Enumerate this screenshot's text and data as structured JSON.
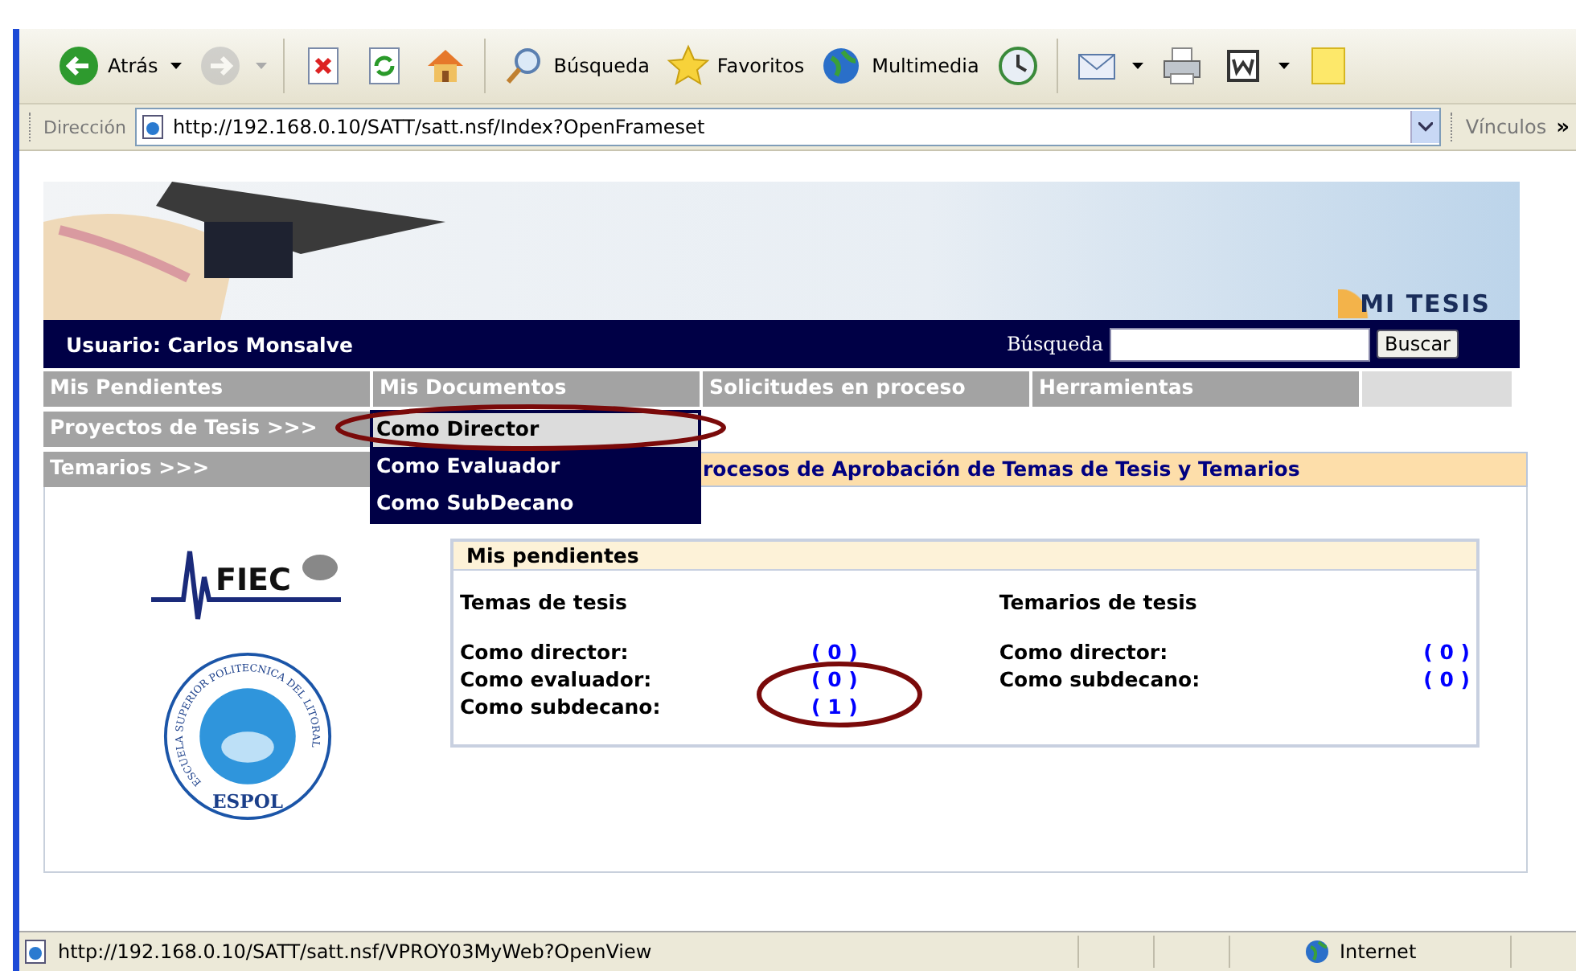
{
  "toolbar": [
    {
      "kind": "back",
      "label": "Atrás",
      "caret": true,
      "disabled": false
    },
    {
      "kind": "forward",
      "caret": true,
      "disabled": true
    },
    {
      "kind": "stop",
      "disabled": false
    },
    {
      "kind": "refresh",
      "disabled": false
    },
    {
      "kind": "home",
      "disabled": false
    },
    {
      "kind": "search",
      "label": "Búsqueda",
      "disabled": false
    },
    {
      "kind": "favorites",
      "label": "Favoritos",
      "disabled": false
    },
    {
      "kind": "media",
      "label": "Multimedia",
      "disabled": false
    },
    {
      "kind": "history",
      "disabled": false
    },
    {
      "kind": "mail",
      "caret": true,
      "disabled": false
    },
    {
      "kind": "print",
      "disabled": false
    },
    {
      "kind": "edit",
      "caret": true,
      "disabled": false
    },
    {
      "kind": "note",
      "disabled": false
    }
  ],
  "address_bar": {
    "label": "Dirección",
    "url": "http://192.168.0.10/SATT/satt.nsf/Index?OpenFrameset",
    "links_label": "Vínculos",
    "more": "»"
  },
  "page": {
    "banner_title": "MI TESIS",
    "user": "Usuario: Carlos Monsalve",
    "search": {
      "label": "Búsqueda",
      "button": "Buscar"
    },
    "menu": [
      {
        "label": "Mis Pendientes"
      },
      {
        "label": "Mis Documentos"
      },
      {
        "label": "Solicitudes en proceso"
      },
      {
        "label": "Herramientas"
      }
    ],
    "side_links": [
      "Proyectos de Tesis >>>",
      "Temarios >>>"
    ],
    "dropdown": [
      {
        "label": "Como Director",
        "selected": true
      },
      {
        "label": "Como Evaluador",
        "selected": false
      },
      {
        "label": "Como SubDecano",
        "selected": false
      }
    ],
    "section_title": "rocesos de Aprobación de Temas de Tesis y Temarios",
    "logos": {
      "fiec": "FIEC",
      "espol": "ESPOL",
      "espol_ring": "ESCUELA SUPERIOR POLITECNICA DEL LITORAL"
    },
    "panel": {
      "title": "Mis pendientes",
      "columns": [
        {
          "heading": "Temas de tesis",
          "rows": [
            {
              "label": "Como director:",
              "count": "( 0 )"
            },
            {
              "label": "Como evaluador:",
              "count": "( 0 )"
            },
            {
              "label": "Como subdecano:",
              "count": "( 1 )"
            }
          ]
        },
        {
          "heading": "Temarios de tesis",
          "rows": [
            {
              "label": "Como director:",
              "count": "( 0 )"
            },
            {
              "label": "Como subdecano:",
              "count": "( 0 )"
            }
          ]
        }
      ]
    }
  },
  "status_bar": {
    "url": "http://192.168.0.10/SATT/satt.nsf/VPROY03MyWeb?OpenView",
    "zone": "Internet"
  }
}
